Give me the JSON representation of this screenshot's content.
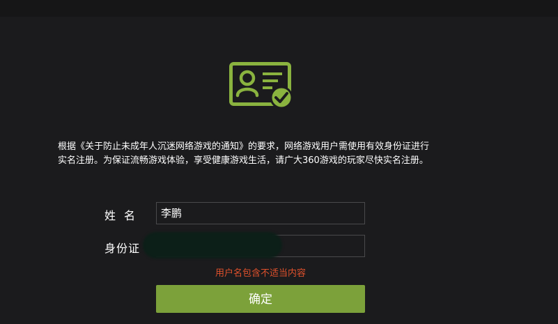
{
  "colors": {
    "background": "#1b1b1d",
    "accent": "#7ca13a",
    "error": "#e0512c",
    "field_border": "#4a4a4c"
  },
  "icon": "id-card-verified-icon",
  "notice": {
    "line1": "根据《关于防止未成年人沉迷网络游戏的通知》的要求，网络游戏用户需使用有效身份证进行",
    "line2": "实名注册。为保证流畅游戏体验，享受健康游戏生活，请广大360游戏的玩家尽快实名注册。"
  },
  "form": {
    "name_label": "姓名",
    "name_value": "李鹏",
    "id_label": "身份证",
    "id_value": "",
    "error": "用户名包含不适当内容",
    "confirm_label": "确定"
  }
}
